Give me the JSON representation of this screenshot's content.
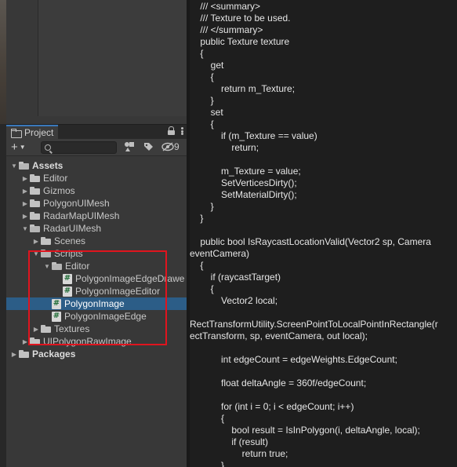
{
  "project_panel": {
    "tab_label": "Project",
    "search": {
      "value": "",
      "placeholder": ""
    },
    "hidden_count": "9",
    "tree": [
      {
        "label": "Assets",
        "depth": 0,
        "expanded": true,
        "type": "folder",
        "bold": true
      },
      {
        "label": "Editor",
        "depth": 1,
        "expanded": false,
        "type": "folder"
      },
      {
        "label": "Gizmos",
        "depth": 1,
        "expanded": false,
        "type": "folder"
      },
      {
        "label": "PolygonUIMesh",
        "depth": 1,
        "expanded": false,
        "type": "folder"
      },
      {
        "label": "RadarMapUIMesh",
        "depth": 1,
        "expanded": false,
        "type": "folder"
      },
      {
        "label": "RadarUIMesh",
        "depth": 1,
        "expanded": true,
        "type": "folder"
      },
      {
        "label": "Scenes",
        "depth": 2,
        "expanded": false,
        "type": "folder"
      },
      {
        "label": "Scripts",
        "depth": 2,
        "expanded": true,
        "type": "folder"
      },
      {
        "label": "Editor",
        "depth": 3,
        "expanded": true,
        "type": "folder"
      },
      {
        "label": "PolygonImageEdgeDrawe",
        "depth": 4,
        "type": "script"
      },
      {
        "label": "PolygonImageEditor",
        "depth": 4,
        "type": "script"
      },
      {
        "label": "PolygonImage",
        "depth": 3,
        "type": "script",
        "selected": true
      },
      {
        "label": "PolygonImageEdge",
        "depth": 3,
        "type": "script"
      },
      {
        "label": "Textures",
        "depth": 2,
        "expanded": false,
        "type": "folder"
      },
      {
        "label": "UIPolygonRawImage",
        "depth": 1,
        "expanded": false,
        "type": "folder"
      },
      {
        "label": "Packages",
        "depth": 0,
        "expanded": false,
        "type": "folder",
        "bold": true
      }
    ]
  },
  "code_lines": [
    "    /// <summary>",
    "    /// Texture to be used.",
    "    /// </summary>",
    "    public Texture texture",
    "    {",
    "        get",
    "        {",
    "            return m_Texture;",
    "        }",
    "        set",
    "        {",
    "            if (m_Texture == value)",
    "                return;",
    "",
    "            m_Texture = value;",
    "            SetVerticesDirty();",
    "            SetMaterialDirty();",
    "        }",
    "    }",
    "",
    "    public bool IsRaycastLocationValid(Vector2 sp, Camera",
    "eventCamera)",
    "    {",
    "        if (raycastTarget)",
    "        {",
    "            Vector2 local;",
    "",
    "RectTransformUtility.ScreenPointToLocalPointInRectangle(r",
    "ectTransform, sp, eventCamera, out local);",
    "",
    "            int edgeCount = edgeWeights.EdgeCount;",
    "",
    "            float deltaAngle = 360f/edgeCount;",
    "",
    "            for (int i = 0; i < edgeCount; i++)",
    "            {",
    "                bool result = IsInPolygon(i, deltaAngle, local);",
    "                if (result)",
    "                    return true;",
    "            }"
  ]
}
